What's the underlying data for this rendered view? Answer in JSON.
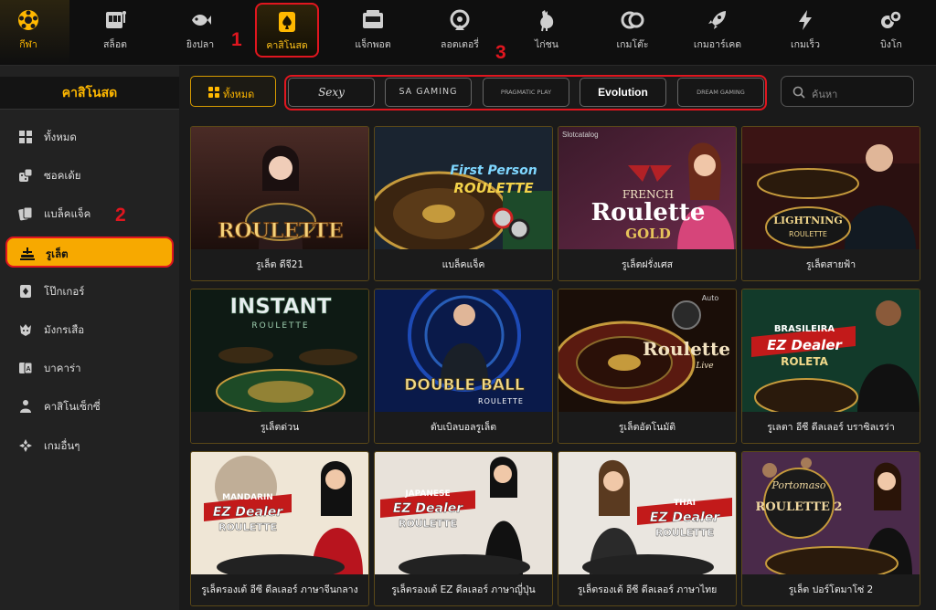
{
  "topnav": {
    "items": [
      {
        "label": "กีฬา",
        "icon": "soccer-ball-icon"
      },
      {
        "label": "สล็อต",
        "icon": "slot-machine-icon"
      },
      {
        "label": "ยิงปลา",
        "icon": "fish-icon"
      },
      {
        "label": "คาสิโนสด",
        "icon": "spade-card-icon"
      },
      {
        "label": "แจ็กพอต",
        "icon": "jackpot-machine-icon"
      },
      {
        "label": "ลอตเตอรี่",
        "icon": "lottery-wheel-icon"
      },
      {
        "label": "ไก่ชน",
        "icon": "rooster-icon"
      },
      {
        "label": "เกมโต๊ะ",
        "icon": "chips-icon"
      },
      {
        "label": "เกมอาร์เคด",
        "icon": "rocket-icon"
      },
      {
        "label": "เกมเร็ว",
        "icon": "lightning-icon"
      },
      {
        "label": "บิงโก",
        "icon": "bingo-balls-icon"
      }
    ],
    "active_index": 3
  },
  "markers": {
    "one": "1",
    "two": "2",
    "three": "3"
  },
  "sidebar": {
    "title": "คาสิโนสด",
    "items": [
      {
        "label": "ทั้งหมด",
        "icon": "grid-icon"
      },
      {
        "label": "ซอคเด้ย",
        "icon": "dice-icon"
      },
      {
        "label": "แบล็คแจ็ค",
        "icon": "cards-icon"
      },
      {
        "label": "รูเล็ต",
        "icon": "roulette-icon"
      },
      {
        "label": "โป๊กเกอร์",
        "icon": "poker-card-icon"
      },
      {
        "label": "มังกรเสือ",
        "icon": "dragon-tiger-icon"
      },
      {
        "label": "บาคาร่า",
        "icon": "baccarat-icon"
      },
      {
        "label": "คาสิโนเซ็กซี่",
        "icon": "sexy-casino-icon"
      },
      {
        "label": "เกมอื่นๆ",
        "icon": "other-games-icon"
      }
    ],
    "active_index": 3
  },
  "filter": {
    "all_label": "ทั้งหมด",
    "providers": [
      "Sexy",
      "SA GAMING",
      "PRAGMATIC PLAY",
      "Evolution",
      "DREAM GAMING"
    ],
    "search_placeholder": "ค้นหา"
  },
  "colors": {
    "accent": "#ffb800",
    "highlight_red": "#e0161f",
    "background": "#1a1a1a"
  },
  "games": [
    {
      "name": "รูเล็ต ดีจี21",
      "art": "ROULETTE",
      "art_small": ""
    },
    {
      "name": "แบล็คแจ็ค",
      "art": "First Person",
      "art_small": "ROULETTE"
    },
    {
      "name": "รูเล็ตฝรั่งเศส",
      "art": "Roulette",
      "art_small": "FRENCH",
      "art_extra": "GOLD",
      "badge": "Slotcatalog"
    },
    {
      "name": "รูเล็ตสายฟ้า",
      "art": "LIGHTNING",
      "art_small": "ROULETTE"
    },
    {
      "name": "รูเล็ตด่วน",
      "art": "INSTANT",
      "art_small": "ROULETTE"
    },
    {
      "name": "ดับเบิลบอลรูเล็ต",
      "art": "DOUBLE BALL",
      "art_small": "ROULETTE"
    },
    {
      "name": "รูเล็ตอัตโนมัติ",
      "art": "Roulette",
      "art_small": "Live",
      "art_extra": "Auto"
    },
    {
      "name": "รูเลตา อีซี ดีลเลอร์ บราซิลเรร่า",
      "art": "EZ Dealer",
      "art_small": "BRASILEIRA",
      "art_extra": "ROLETA"
    },
    {
      "name": "รูเล็ตรองเต้ อีซี ดีลเลอร์ ภาษาจีนกลาง",
      "art": "EZ Dealer",
      "art_small": "MANDARIN",
      "art_extra": "ROULETTE"
    },
    {
      "name": "รูเล็ตรองเต้ EZ ดีลเลอร์ ภาษาญี่ปุ่น",
      "art": "EZ Dealer",
      "art_small": "JAPANESE",
      "art_extra": "ROULETTE"
    },
    {
      "name": "รูเล็ตรองเต้ อีซี ดีลเลอร์ ภาษาไทย",
      "art": "EZ Dealer",
      "art_small": "THAI",
      "art_extra": "ROULETTE"
    },
    {
      "name": "รูเล็ต ปอร์โตมาโซ่ 2",
      "art": "Portomaso",
      "art_small": "ROULETTE 2"
    }
  ]
}
